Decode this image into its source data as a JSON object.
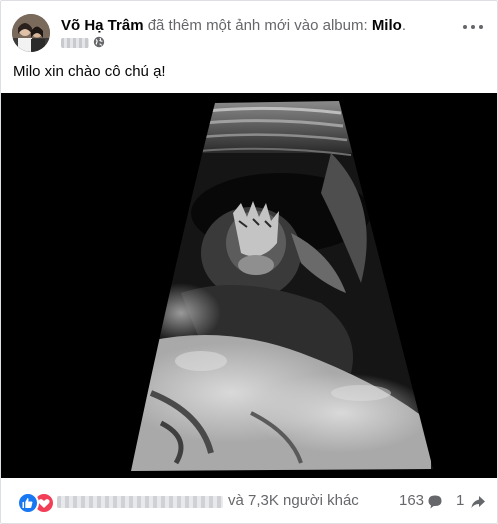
{
  "post": {
    "author": "Võ Hạ Trâm",
    "action": " đã thêm một ảnh mới vào album: ",
    "album": "Milo",
    "album_suffix": ".",
    "privacy_icon": "globe-icon",
    "caption": "Milo xin chào cô chú ạ!",
    "photo_icon": "ultrasound-photo"
  },
  "reactions": {
    "icons": [
      "like-icon",
      "love-icon"
    ],
    "others": "và 7,3K người khác",
    "comments": "163",
    "shares": "1"
  },
  "colors": {
    "like": "#1877f2",
    "love": "#f33e58",
    "secondary_text": "#65676b"
  }
}
